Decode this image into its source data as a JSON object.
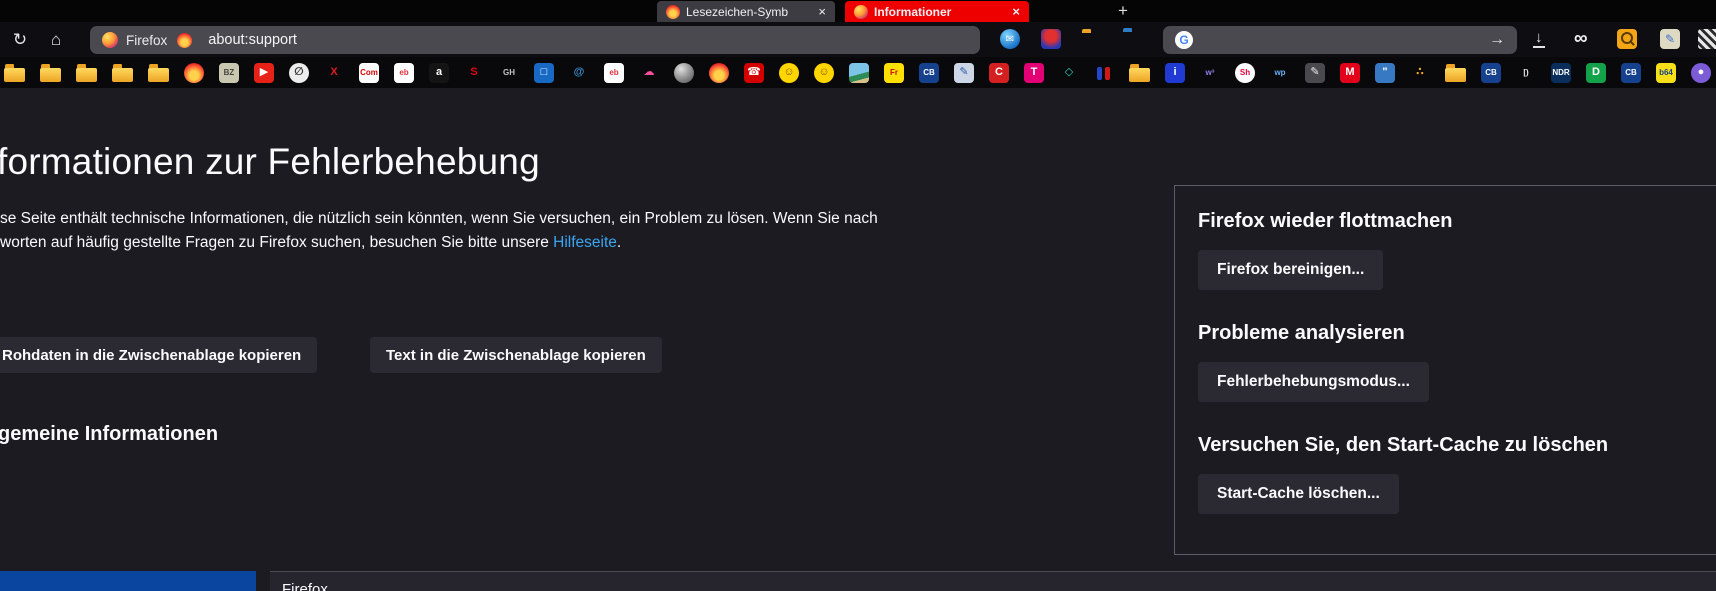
{
  "colors": {
    "selection_blue": "#0a46a0",
    "link": "#3aa6f2",
    "active_tab_red": "#ee0000",
    "button_bg": "#2b2a33",
    "page_bg": "#1c1b22"
  },
  "browser": {
    "tabs": [
      {
        "label": "Lesezeichen-Symb",
        "close": "×",
        "active": false
      },
      {
        "label": "Informationer",
        "close": "×",
        "active": true
      }
    ],
    "new_tab": "+",
    "nav": {
      "chip_label": "Firefox",
      "url": "about:support"
    },
    "search": {
      "engine_letter": "G",
      "submit_arrow": "→"
    },
    "bookmarks": [
      {
        "n": "folder",
        "t": "f"
      },
      {
        "n": "folder",
        "t": "f"
      },
      {
        "n": "folder",
        "t": "f"
      },
      {
        "n": "folder",
        "t": "f"
      },
      {
        "n": "folder",
        "t": "f"
      },
      {
        "n": "flame",
        "t": "flame"
      },
      {
        "n": "bz",
        "t": "s",
        "g": "BZ",
        "bg": "#c9c7b0",
        "fg": "#44443c"
      },
      {
        "n": "youtube",
        "t": "s",
        "g": "▶",
        "bg": "#e62117",
        "fg": "#ffffff"
      },
      {
        "n": "circle-slash",
        "t": "c",
        "g": "∅",
        "bg": "#ededed",
        "fg": "#333333"
      },
      {
        "n": "x-red",
        "t": "s",
        "g": "X",
        "fg": "#e01b24"
      },
      {
        "n": "computerbild-com",
        "t": "s",
        "g": "Com",
        "bg": "#ffffff",
        "fg": "#d40000"
      },
      {
        "n": "ebay",
        "t": "s",
        "g": "eb",
        "bg": "#ffffff",
        "fg": "#e53238"
      },
      {
        "n": "amazon",
        "t": "s",
        "g": "a",
        "bg": "#141414",
        "fg": "#ffffff"
      },
      {
        "n": "sparkasse",
        "t": "s",
        "g": "S",
        "fg": "#e30613"
      },
      {
        "n": "gh",
        "t": "s",
        "g": "GH",
        "fg": "#c4c4c4"
      },
      {
        "n": "monitor",
        "t": "s",
        "g": "□",
        "bg": "#1769c4",
        "fg": "#ffffff"
      },
      {
        "n": "rocket-at",
        "t": "s",
        "g": "@",
        "fg": "#3d8fd1"
      },
      {
        "n": "ebay",
        "t": "s",
        "g": "eb",
        "bg": "#ffffff",
        "fg": "#e53238"
      },
      {
        "n": "cloud-up",
        "t": "s",
        "g": "☁",
        "fg": "#ff4fa3"
      },
      {
        "n": "sphere",
        "t": "c",
        "bg": "radial-gradient(circle at 35% 30%, #e0e0e0, #8a8a8a 55%, #4a4a4a)"
      },
      {
        "n": "flame",
        "t": "flame"
      },
      {
        "n": "phonebook",
        "t": "s",
        "g": "☎",
        "bg": "#d40000",
        "fg": "#ffffff"
      },
      {
        "n": "smiley-tongue",
        "t": "c",
        "g": "☺",
        "bg": "#ffd600",
        "fg": "#7a5800"
      },
      {
        "n": "smiley",
        "t": "c",
        "g": "☺",
        "bg": "#ffd600",
        "fg": "#7a5800"
      },
      {
        "n": "palm-photo",
        "t": "s",
        "bg": "linear-gradient(165deg,#7cc4e8 0 55%,#2e8b57 55% 78%,#d9c08a 78%)"
      },
      {
        "n": "fritz",
        "t": "s",
        "g": "Fr",
        "bg": "#ffe000",
        "fg": "#d40000"
      },
      {
        "n": "computerbild-cb",
        "t": "s",
        "g": "CB",
        "bg": "#15418f",
        "fg": "#ffffff"
      },
      {
        "n": "clipboard-pencil",
        "t": "s",
        "g": "✎",
        "bg": "#cdd6e6",
        "fg": "#2b58a8"
      },
      {
        "n": "c-red",
        "t": "s",
        "g": "C",
        "bg": "#d42020",
        "fg": "#ffffff"
      },
      {
        "n": "telekom",
        "t": "s",
        "g": "T",
        "bg": "#e20074",
        "fg": "#ffffff"
      },
      {
        "n": "diamond",
        "t": "s",
        "g": "◇",
        "fg": "#35d0c0"
      },
      {
        "n": "duo-figures",
        "t": "duo"
      },
      {
        "n": "folder",
        "t": "f"
      },
      {
        "n": "info-blue",
        "t": "s",
        "g": "i",
        "bg": "#1f3bd3",
        "fg": "#ffffff"
      },
      {
        "n": "w3",
        "t": "s",
        "g": "w³",
        "fg": "#9080e8"
      },
      {
        "n": "sh",
        "t": "c",
        "g": "Sh",
        "bg": "#ffffff",
        "fg": "#e4003a"
      },
      {
        "n": "wp",
        "t": "s",
        "g": "wp",
        "fg": "#6aaef5"
      },
      {
        "n": "pen",
        "t": "s",
        "g": "✎",
        "bg": "#4a4a4e",
        "fg": "#eeeeee"
      },
      {
        "n": "mail-m",
        "t": "s",
        "g": "M",
        "bg": "#e2001a",
        "fg": "#ffffff"
      },
      {
        "n": "chat-bubble",
        "t": "s",
        "g": "\"",
        "bg": "#3779c2",
        "fg": "#ffffff"
      },
      {
        "n": "dots",
        "t": "s",
        "g": "∴",
        "fg": "#f2a615"
      },
      {
        "n": "folder",
        "t": "f"
      },
      {
        "n": "computerbild-cb",
        "t": "s",
        "g": "CB",
        "bg": "#15418f",
        "fg": "#ffffff"
      },
      {
        "n": "brackets",
        "t": "s",
        "g": "[)",
        "fg": "#eeeeee"
      },
      {
        "n": "ndr",
        "t": "s",
        "g": "NDR",
        "bg": "#0a2e5c",
        "fg": "#ffffff"
      },
      {
        "n": "d-green",
        "t": "s",
        "g": "D",
        "bg": "#13a24a",
        "fg": "#ffffff"
      },
      {
        "n": "computerbild-cb",
        "t": "s",
        "g": "CB",
        "bg": "#15418f",
        "fg": "#ffffff"
      },
      {
        "n": "b64",
        "t": "s",
        "g": "b64",
        "bg": "#f7e017",
        "fg": "#15418f"
      },
      {
        "n": "pin",
        "t": "c",
        "g": "●",
        "bg": "#7b5bd6",
        "fg": "#ffffff"
      }
    ]
  },
  "icons": {
    "reload": "↻",
    "home": "⌂",
    "mail": "✉",
    "download": "↓",
    "infinity": "∞",
    "page_tool": "✎",
    "arrow_right": "→"
  },
  "page": {
    "title": "formationen zur Fehlerbehebung",
    "intro_line1": "se Seite enthält technische Informationen, die nützlich sein könnten, wenn Sie versuchen, ein Problem zu lösen. Wenn Sie nach",
    "intro_line2": "worten auf häufig gestellte Fragen zu Firefox suchen, besuchen Sie bitte unsere ",
    "intro_link": "Hilfeseite",
    "intro_period": ".",
    "copy_raw_button": "Rohdaten in die Zwischenablage kopieren",
    "copy_text_button": "Text in die Zwischenablage kopieren",
    "section_heading": "gemeine Informationen",
    "table": {
      "first_value": "Firefox"
    }
  },
  "panel": {
    "sections": [
      {
        "heading": "Firefox wieder flottmachen",
        "button": "Firefox bereinigen..."
      },
      {
        "heading": "Probleme analysieren",
        "button": "Fehlerbehebungsmodus..."
      },
      {
        "heading": "Versuchen Sie, den Start-Cache zu löschen",
        "button": "Start-Cache löschen..."
      }
    ]
  }
}
